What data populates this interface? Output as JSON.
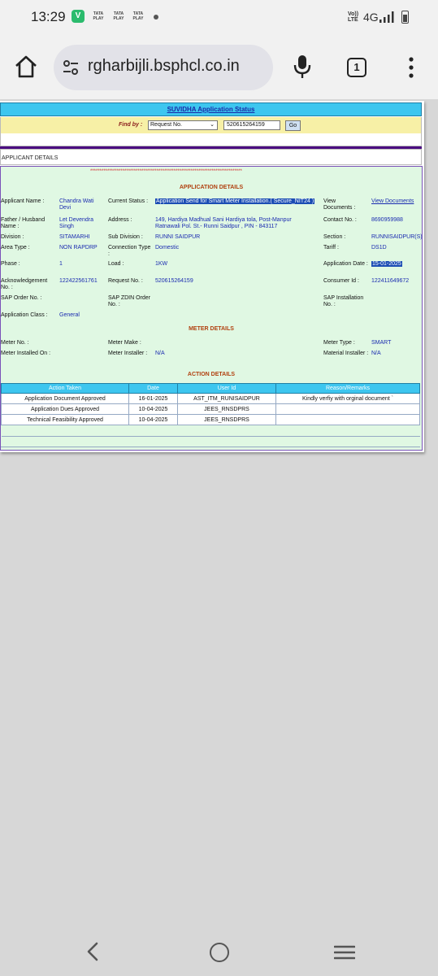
{
  "status_bar": {
    "time": "13:29",
    "app_icon_glyph": "V",
    "tataplay_label": "TATA PLAY",
    "volte": "Vo)) LTE",
    "network": "4G",
    "icons": [
      "vpn-app-icon",
      "tataplay-icon",
      "signal-icon",
      "battery-icon"
    ]
  },
  "browser": {
    "url": "rgharbijli.bsphcl.co.in",
    "tab_count": "1",
    "icons": [
      "home-icon",
      "site-settings-icon",
      "mic-icon",
      "tabs-icon",
      "menu-icon"
    ]
  },
  "form": {
    "title": "SUVIDHA Application Status",
    "find_by_label": "Find by :",
    "find_by_value": "Request No.",
    "search_value": "520615264159",
    "go_label": "Go",
    "applicant_details_tab": "APPLICANT DETAILS"
  },
  "stars": "********************************************************************************",
  "application": {
    "section_title": "APPLICATION DETAILS",
    "applicant_name_label": "Applicant Name :",
    "applicant_name": "Chandra Wati Devi",
    "current_status_label": "Current Status :",
    "current_status": "Application Send for Smart Meter Installation.( Secure_NIT24 )",
    "view_documents_label": "View Documents :",
    "view_documents_link": "View Documents",
    "father_label": "Father / Husband Name :",
    "father": "Let Devendra Singh",
    "address_label": "Address :",
    "address": "149, Hardiya Madhual Sani Hardiya tola, Post-Manpur Ratnawali Pol. St.- Runni Saidpur , PIN - 843117",
    "contact_label": "Contact No. :",
    "contact": "8690959988",
    "division_label": "Division :",
    "division": "SITAMARHI",
    "subdivision_label": "Sub Division :",
    "subdivision": "RUNNI SAIDPUR",
    "section_label": "Section :",
    "section": "RUNNISAIDPUR(S)",
    "area_type_label": "Area Type :",
    "area_type": "NON RAPDRP",
    "connection_type_label": "Connection Type :",
    "connection_type": "Domestic",
    "tariff_label": "Tariff :",
    "tariff": "DS1D",
    "phase_label": "Phase :",
    "phase": "1",
    "load_label": "Load :",
    "load": "1KW",
    "application_date_label": "Application Date :",
    "application_date": "15-01-2025",
    "ack_label": "Acknowledgement No. :",
    "ack": "122422561761",
    "request_label": "Request No. :",
    "request": "520615264159",
    "consumer_label": "Consumer Id :",
    "consumer": "122411649672",
    "sap_order_label": "SAP Order No. :",
    "sap_zdin_label": "SAP ZDIN Order No. :",
    "sap_install_label": "SAP Installation No. :",
    "app_class_label": "Application Class :",
    "app_class": "General"
  },
  "meter": {
    "section_title": "METER DETAILS",
    "meter_no_label": "Meter No. :",
    "meter_make_label": "Meter Make :",
    "meter_type_label": "Meter Type :",
    "meter_type": "SMART",
    "installed_on_label": "Meter Installed On :",
    "installer_label": "Meter Installer :",
    "installer": "N/A",
    "material_label": "Material Installer :",
    "material": "N/A"
  },
  "action": {
    "section_title": "ACTION DETAILS",
    "headers": [
      "Action Taken",
      "Date",
      "User Id",
      "Reason/Remarks"
    ],
    "rows": [
      [
        "Application Document Approved",
        "16-01-2025",
        "AST_ITM_RUNISAIDPUR",
        "Kindly verfiy with orginal document `"
      ],
      [
        "Application Dues Approved",
        "10-04-2025",
        "JEES_RNSDPRS",
        ""
      ],
      [
        "Technical Feasibility Approved",
        "10-04-2025",
        "JEES_RNSDPRS",
        ""
      ]
    ]
  },
  "navbar": {
    "icons": [
      "back-icon",
      "home-circle-icon",
      "recents-icon"
    ]
  }
}
